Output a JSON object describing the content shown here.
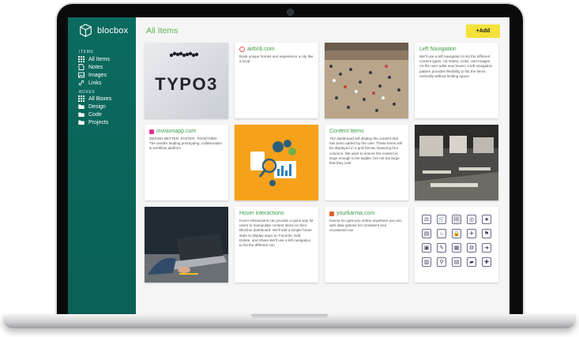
{
  "app": {
    "name": "blocbox"
  },
  "sidebar": {
    "items_header": "ITEMS",
    "items": [
      {
        "label": "All Items",
        "icon": "grid-icon"
      },
      {
        "label": "Notes",
        "icon": "note-icon"
      },
      {
        "label": "Images",
        "icon": "image-icon"
      },
      {
        "label": "Links",
        "icon": "link-icon"
      }
    ],
    "boxes_header": "BOXES",
    "boxes": [
      {
        "label": "All Boxes",
        "icon": "grid-icon"
      },
      {
        "label": "Design",
        "icon": "folder-icon"
      },
      {
        "label": "Code",
        "icon": "folder-icon"
      },
      {
        "label": "Projects",
        "icon": "folder-icon"
      }
    ]
  },
  "main": {
    "title": "All Items",
    "add_label": "+Add"
  },
  "cards": [
    {
      "type": "image",
      "image_text": "TYPO3"
    },
    {
      "type": "link",
      "badge_color": "#e9535b",
      "title": "airbnb.com",
      "body": "Book unique homes and experience a city like a local."
    },
    {
      "type": "image",
      "subject": "crowd-photo"
    },
    {
      "type": "note",
      "title": "Left Navigation",
      "body": "We'll use a left navigation to list the different content types. All, Notes, Links, and Images. As the user adds new boxes, a left navigation pattern provides flexibility to list the items vertically without limiting space."
    },
    {
      "type": "link",
      "badge_color": "#e8358c",
      "title": "invisionapp.com",
      "body": "DESIGN BETTER. FASTER. TOGETHER. The world's leading prototyping, collaboration & workflow platform"
    },
    {
      "type": "image",
      "subject": "analytics-illustration"
    },
    {
      "type": "note",
      "title": "Content Items",
      "body": "The dashboard will display the content that has been added by the user. These items will be displayed in a grid format, featuring four columns. We want to ensure the content is large enough to be legible, but not too large that they over"
    },
    {
      "type": "image",
      "subject": "office-photo"
    },
    {
      "type": "image",
      "subject": "laptop-photo"
    },
    {
      "type": "note",
      "title": "Hover interactions",
      "body": "Hover interactions can provide a quick way for users to manipulate content items on their Blocbox dashboard. We'll add a simple hover state to display ways to; Favorite, Edit, Delete, and Share.We'll use a left navigation to list the different con"
    },
    {
      "type": "link",
      "badge_color": "#e85c2e",
      "title": "yourkarma.com",
      "body": "Karma Go gets you online anywhere you are, with data options for consistent and occasional use"
    },
    {
      "type": "image",
      "subject": "icon-set",
      "icons": [
        "⚖",
        "🛒",
        "🖼",
        "◎",
        "★",
        "▤",
        "⌂",
        "🔒",
        "✈",
        "⚑",
        "▣",
        "✎",
        "▦",
        "⚙",
        "➜",
        "▥",
        "⚲",
        "▤",
        "▰",
        "✚"
      ]
    }
  ],
  "colors": {
    "sidebar": "#0b6b5f",
    "accent_green": "#5bb04c",
    "add_button": "#f4e23a"
  }
}
